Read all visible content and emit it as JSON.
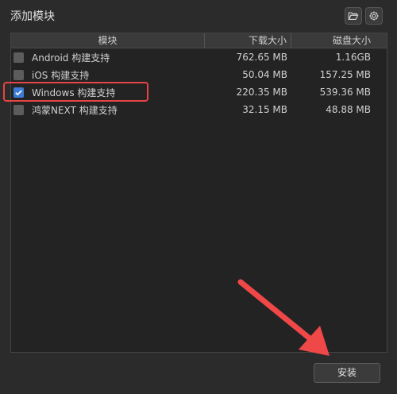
{
  "dialog": {
    "title": "添加模块"
  },
  "toolbar": {
    "folder_icon": "folder-open-icon",
    "settings_icon": "gear-icon"
  },
  "table": {
    "columns": [
      "模块",
      "下载大小",
      "磁盘大小"
    ],
    "rows": [
      {
        "name": "Android 构建支持",
        "download": "762.65 MB",
        "disk": "1.16GB",
        "checked": false
      },
      {
        "name": "iOS 构建支持",
        "download": "50.04 MB",
        "disk": "157.25 MB",
        "checked": false
      },
      {
        "name": "Windows 构建支持",
        "download": "220.35 MB",
        "disk": "539.36 MB",
        "checked": true
      },
      {
        "name": "鸿蒙NEXT 构建支持",
        "download": "32.15 MB",
        "disk": "48.88 MB",
        "checked": false
      }
    ]
  },
  "actions": {
    "install_label": "安装"
  },
  "colors": {
    "highlight": "#e64545",
    "arrow": "#f04848",
    "checkbox_checked": "#3d7bd6"
  }
}
